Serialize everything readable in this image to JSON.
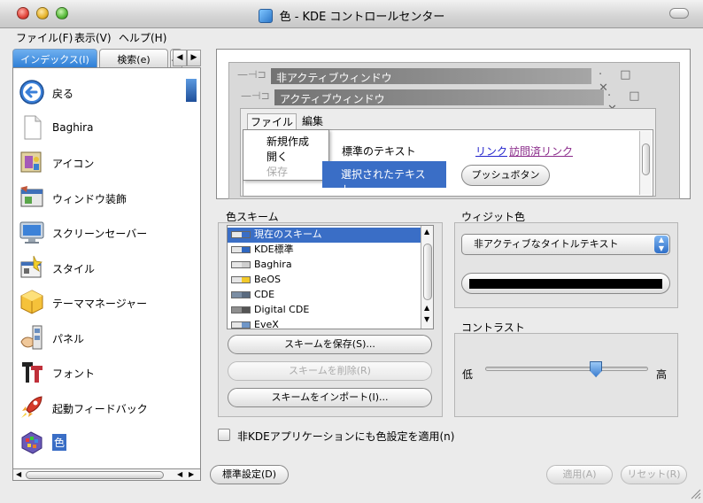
{
  "window": {
    "title": "色 - KDE コントロールセンター"
  },
  "menubar": {
    "items": [
      "ファイル(F)",
      "表示(V)",
      "ヘルプ(H)"
    ]
  },
  "tabs": {
    "index": "インデックス(I)",
    "search": "検索(e)",
    "cut": "ヘ"
  },
  "nav": {
    "items": [
      {
        "label": "戻る",
        "icon": "back-arrow-icon"
      },
      {
        "label": "Baghira",
        "icon": "document-icon"
      },
      {
        "label": "アイコン",
        "icon": "icons-icon"
      },
      {
        "label": "ウィンドウ装飾",
        "icon": "window-decoration-icon"
      },
      {
        "label": "スクリーンセーバー",
        "icon": "monitor-icon"
      },
      {
        "label": "スタイル",
        "icon": "style-icon"
      },
      {
        "label": "テーママネージャー",
        "icon": "theme-cube-icon"
      },
      {
        "label": "パネル",
        "icon": "panel-icon"
      },
      {
        "label": "フォント",
        "icon": "fonts-icon"
      },
      {
        "label": "起動フィードバック",
        "icon": "rocket-icon"
      },
      {
        "label": "色",
        "icon": "color-palette-icon"
      }
    ],
    "selected_index": 10
  },
  "preview": {
    "inactive_title": "非アクティブウィンドウ",
    "active_title": "アクティブウィンドウ",
    "menu_file": "ファイル",
    "menu_edit": "編集",
    "popup_new": "新規作成",
    "popup_open": "開く",
    "popup_save": "保存",
    "normal_text": "標準のテキスト",
    "selected_text": "選択されたテキスト",
    "link": "リンク",
    "visited_link": "訪問済リンク",
    "push_button": "プッシュボタン",
    "window_buttons": "· □ ✕"
  },
  "scheme": {
    "label": "色スキーム",
    "items": [
      {
        "name": "現在のスキーム",
        "swatch": "#e8e8e8",
        "accent": "#3a6ec6"
      },
      {
        "name": "KDE標準",
        "swatch": "#e6e6e6",
        "accent": "#2f67c0"
      },
      {
        "name": "Baghira",
        "swatch": "#e6e6e6",
        "accent": "#cfcfcf"
      },
      {
        "name": "BeOS",
        "swatch": "#e6e6e6",
        "accent": "#f2c92a"
      },
      {
        "name": "CDE",
        "swatch": "#7b8ea4",
        "accent": "#5a6b80"
      },
      {
        "name": "Digital CDE",
        "swatch": "#8f8f8f",
        "accent": "#555555"
      },
      {
        "name": "EveX",
        "swatch": "#e6e6e6",
        "accent": "#6f96c8"
      }
    ],
    "selected_index": 0,
    "save_button": "スキームを保存(S)...",
    "delete_button": "スキームを削除(R)",
    "import_button": "スキームをインポート(I)..."
  },
  "widget": {
    "label": "ウィジット色",
    "selected": "非アクティブなタイトルテキスト",
    "color": "#000000"
  },
  "contrast": {
    "label": "コントラスト",
    "low": "低",
    "high": "高",
    "level_fraction": 0.68
  },
  "apply_nonkde": {
    "label": "非KDEアプリケーションにも色設定を適用(n)",
    "checked": false
  },
  "bottom": {
    "defaults": "標準設定(D)",
    "apply": "適用(A)",
    "reset": "リセット(R)"
  },
  "colors": {
    "selection": "#3a6ec6",
    "link": "#2222cc",
    "visited": "#8a2a8a"
  }
}
